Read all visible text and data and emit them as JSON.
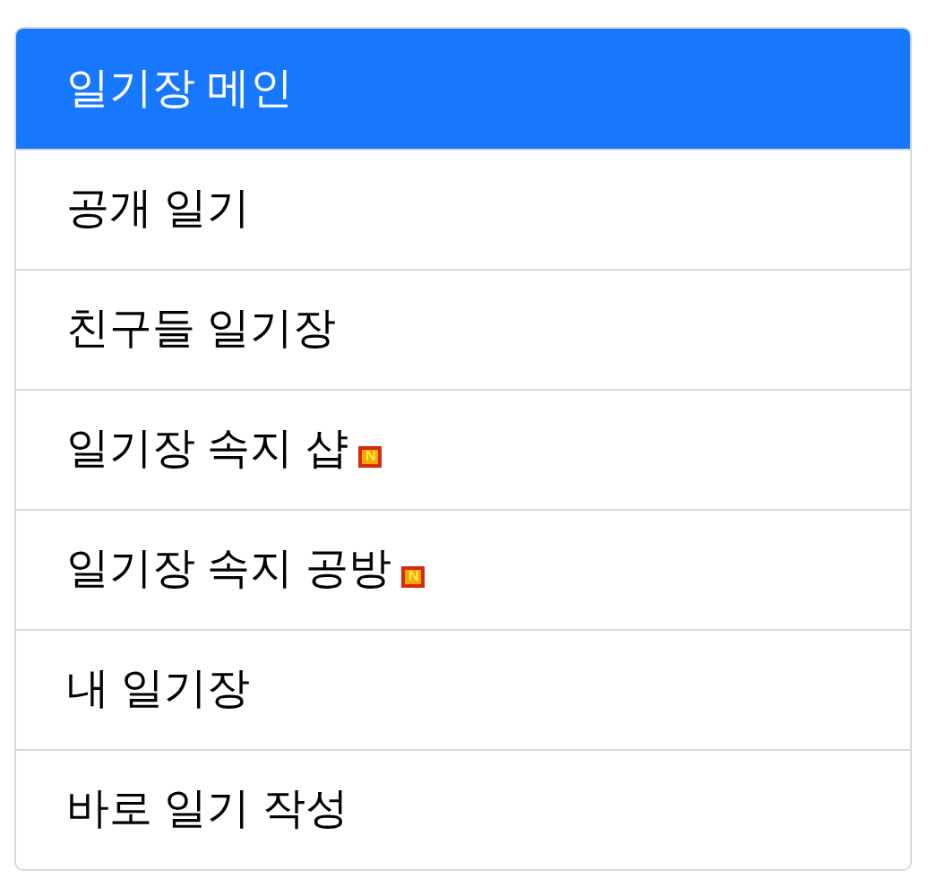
{
  "menu": [
    {
      "label": "일기장 메인",
      "selected": true
    },
    {
      "label": "공개 일기",
      "selected": false
    },
    {
      "label": "친구들 일기장",
      "selected": false
    },
    {
      "label": "일기장 속지 샵",
      "selected": false,
      "badge": "N"
    },
    {
      "label": "일기장 속지 공방",
      "selected": false,
      "badge": "N"
    },
    {
      "label": "내 일기장",
      "selected": false
    },
    {
      "label": "바로 일기 작성",
      "selected": false
    }
  ]
}
